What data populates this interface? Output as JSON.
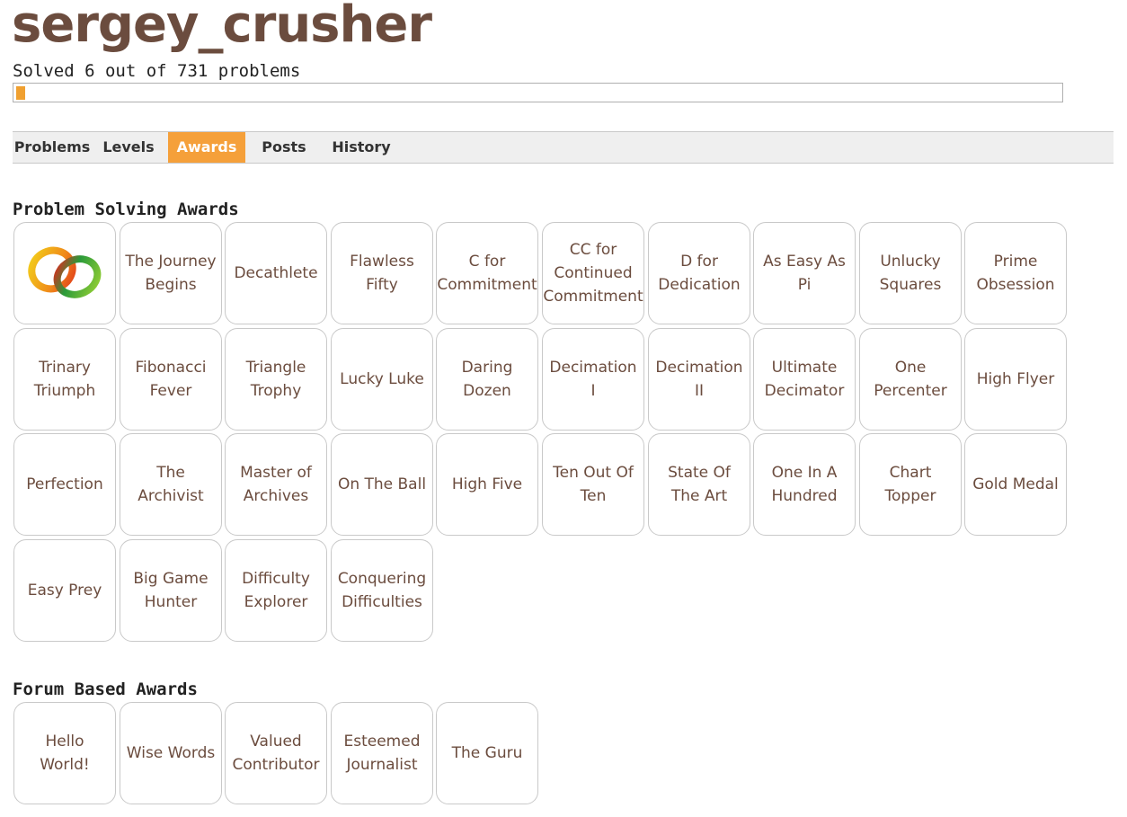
{
  "user": {
    "name": "sergey_crusher",
    "solved_text": "Solved 6 out of 731 problems",
    "solved": 6,
    "total": 731
  },
  "nav": {
    "tabs": [
      "Problems",
      "Levels",
      "Awards",
      "Posts",
      "History"
    ],
    "active": "Awards"
  },
  "colors": {
    "accent": "#f5a03a",
    "title": "#6b4c3e",
    "tile_border": "#c9c9c9"
  },
  "sections": {
    "problem_solving": {
      "title": "Problem Solving Awards",
      "first_icon": "linked-rings-icon",
      "awards": [
        "",
        "The Journey Begins",
        "Decathlete",
        "Flawless Fifty",
        "C for Commitment",
        "CC for Continued Commitment",
        "D for Dedication",
        "As Easy As Pi",
        "Unlucky Squares",
        "Prime Obsession",
        "Trinary Triumph",
        "Fibonacci Fever",
        "Triangle Trophy",
        "Lucky Luke",
        "Daring Dozen",
        "Decimation I",
        "Decimation II",
        "Ultimate Decimator",
        "One Percenter",
        "High Flyer",
        "Perfection",
        "The Archivist",
        "Master of Archives",
        "On The Ball",
        "High Five",
        "Ten Out Of Ten",
        "State Of The Art",
        "One In A Hundred",
        "Chart Topper",
        "Gold Medal",
        "Easy Prey",
        "Big Game Hunter",
        "Difficulty Explorer",
        "Conquering Difficulties"
      ]
    },
    "forum": {
      "title": "Forum Based Awards",
      "awards": [
        "Hello World!",
        "Wise Words",
        "Valued Contributor",
        "Esteemed Journalist",
        "The Guru"
      ]
    }
  }
}
